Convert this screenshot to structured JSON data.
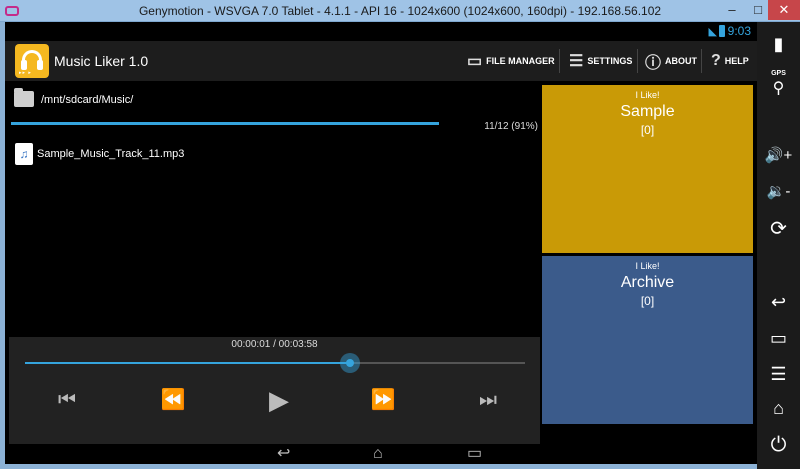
{
  "window": {
    "title": "Genymotion - WSVGA 7.0 Tablet - 4.1.1 - API 16 - 1024x600 (1024x600, 160dpi) - 192.168.56.102",
    "minimize": "–",
    "maximize": "□",
    "close": "✕"
  },
  "status": {
    "time": "9:03",
    "wifi_icon": "wifi-icon",
    "battery_icon": "battery-icon"
  },
  "app": {
    "title": "Music Liker 1.0",
    "icon_label": "▸▸ ▸",
    "actions": [
      {
        "label": "FILE MANAGER",
        "icon": "folder-icon",
        "glyph": "▭"
      },
      {
        "label": "SETTINGS",
        "icon": "list-icon",
        "glyph": "☰"
      },
      {
        "label": "ABOUT",
        "icon": "info-icon",
        "glyph": "ⓘ"
      },
      {
        "label": "HELP",
        "icon": "question-icon",
        "glyph": "?"
      }
    ]
  },
  "browser": {
    "path": "/mnt/sdcard/Music/",
    "scan_count": "11/12 (91%)",
    "scan_progress": 0.91,
    "files": [
      {
        "name": "Sample_Music_Track_11.mp3",
        "glyph": "♫"
      }
    ]
  },
  "player": {
    "position": "00:00:01 / 00:03:58",
    "seek_progress": 0.65,
    "buttons": [
      {
        "name": "skip-previous",
        "glyph": "⏮"
      },
      {
        "name": "rewind",
        "glyph": "⏪"
      },
      {
        "name": "play",
        "glyph": "▶"
      },
      {
        "name": "fast-forward",
        "glyph": "⏩"
      },
      {
        "name": "skip-next",
        "glyph": "⏭"
      }
    ]
  },
  "panels": [
    {
      "like_label": "I Like!",
      "name": "Sample",
      "count": "[0]",
      "color": "#c99a06"
    },
    {
      "like_label": "I Like!",
      "name": "Archive",
      "count": "[0]",
      "color": "#3b5b8b"
    }
  ],
  "navbar": {
    "back": "↩",
    "home": "⌂",
    "recents": "▭"
  },
  "sidebar": {
    "battery": "▮",
    "gps_label": "GPS",
    "gps_glyph": "⚲",
    "vol_up": "🔊+",
    "vol_down": "🔉-",
    "rotate": "⟳",
    "back": "↩",
    "recents": "▭",
    "menu": "☰",
    "home": "⌂",
    "power": "⏻"
  },
  "colors": {
    "accent": "#35a4dd",
    "sample": "#c99a06",
    "archive": "#3b5b8b"
  }
}
